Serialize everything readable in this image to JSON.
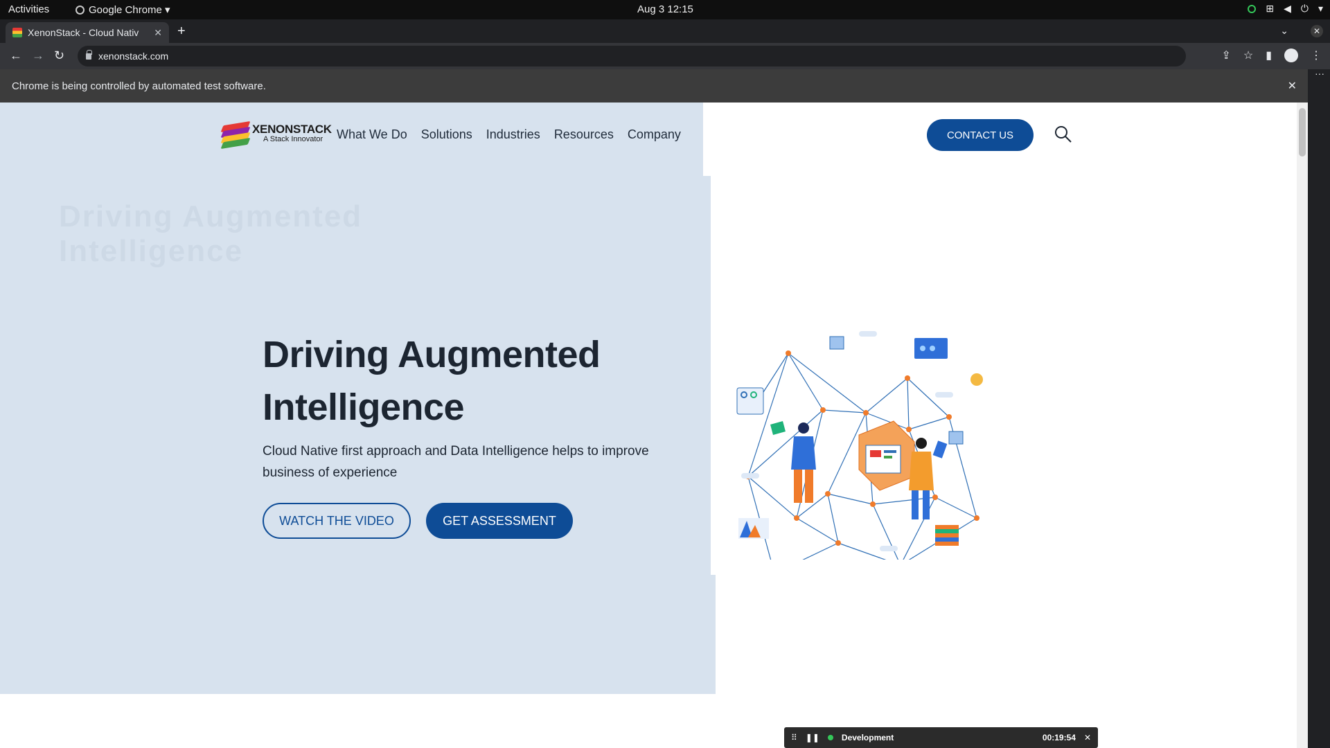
{
  "os": {
    "activities": "Activities",
    "app_name": "Google Chrome ▾",
    "clock": "Aug 3  12:15"
  },
  "browser": {
    "tab_title": "XenonStack - Cloud Nativ",
    "tab_close": "✕",
    "new_tab": "+",
    "url": "xenonstack.com",
    "infobar_text": "Chrome is being controlled by automated test software.",
    "infobar_close": "✕"
  },
  "site": {
    "logo_name": "XENONSTACK",
    "logo_tagline": "A Stack Innovator",
    "nav": [
      "What We Do",
      "Solutions",
      "Industries",
      "Resources",
      "Company"
    ],
    "contact_label": "CONTACT US",
    "hero_title": "Driving Augmented Intelligence",
    "hero_subtitle": "Cloud Native first approach and Data Intelligence helps to improve business of experience",
    "watch_label": "WATCH THE VIDEO",
    "assessment_label": "GET ASSESSMENT",
    "ghost_title": "Driving Augmented Intelligence"
  },
  "recorder": {
    "title": "Development",
    "time": "00:19:54",
    "close": "✕"
  },
  "colors": {
    "brand_blue": "#0e4c96",
    "hero_bg": "#d7e2ee",
    "network_line": "#2f6fb5",
    "network_node": "#f07b2a"
  }
}
